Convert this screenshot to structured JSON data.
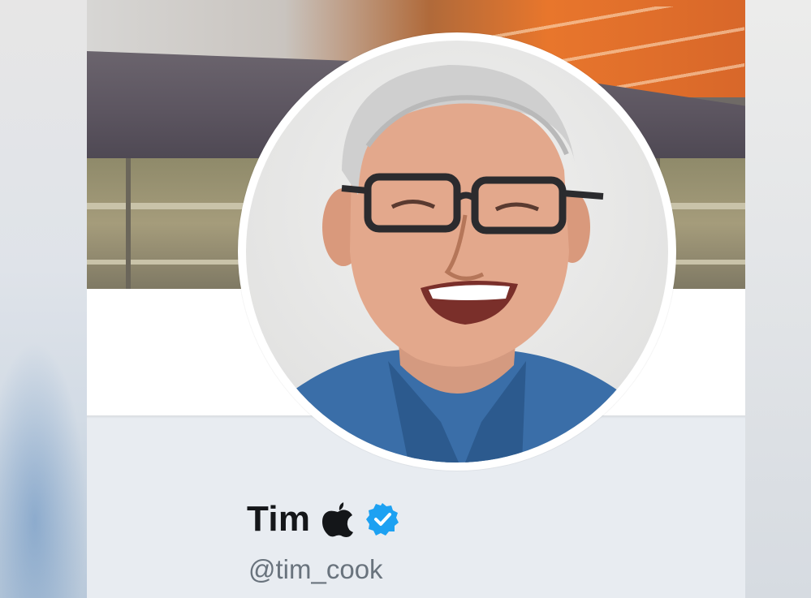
{
  "profile": {
    "display_name": "Tim",
    "handle": "@tim_cook",
    "verified": true,
    "name_emoji_icon": "apple-logo-icon",
    "badge_icon": "verified-badge-icon"
  },
  "colors": {
    "name_text": "#141619",
    "handle_text": "#69737d",
    "verified_blue": "#1da1f2",
    "card_background": "#ffffff",
    "info_background": "#e8ecf1"
  }
}
